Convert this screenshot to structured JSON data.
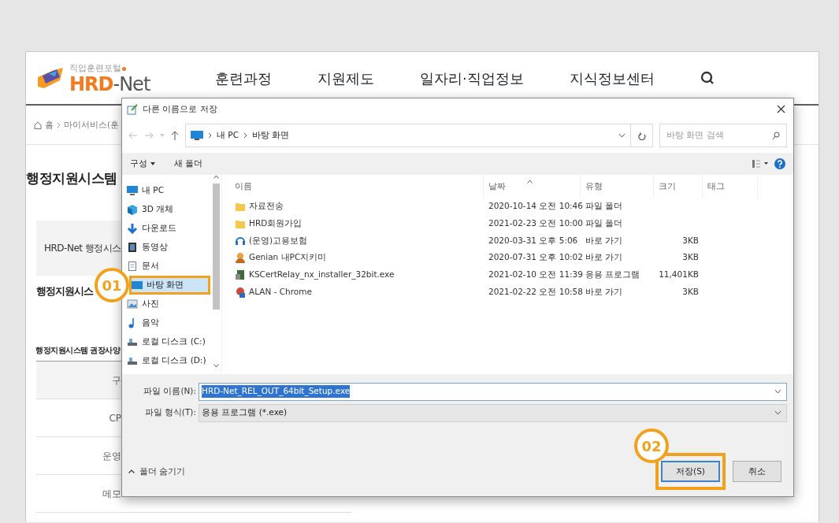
{
  "site": {
    "logo_tagline": "직업훈련포털",
    "logo_brand": "HRD",
    "logo_suffix": "-Net",
    "nav": [
      "훈련과정",
      "지원제도",
      "일자리·직업정보",
      "지식정보센터"
    ],
    "breadcrumb": [
      "홈",
      "마이서비스(훈"
    ],
    "page_title": "행정지원시스템",
    "banner_text": "HRD-Net 행정시스",
    "section_title": "행정지원시스",
    "spec_title": "행정지원시스템 권장사양",
    "spec_rows": [
      {
        "label": "구",
        "kind": "header"
      },
      {
        "label": "CP",
        "kind": "row"
      },
      {
        "label": "운영",
        "kind": "row"
      },
      {
        "label": "메모",
        "kind": "row"
      }
    ]
  },
  "dialog": {
    "title": "다른 이름으로 저장",
    "path": [
      "내 PC",
      "바탕 화면"
    ],
    "search_placeholder": "바탕 화면 검색",
    "toolbar": {
      "organize": "구성",
      "new_folder": "새 폴더"
    },
    "nav_tree": [
      {
        "label": "내 PC",
        "selected": false
      },
      {
        "label": "3D 개체",
        "selected": false
      },
      {
        "label": "다운로드",
        "selected": false
      },
      {
        "label": "동영상",
        "selected": false
      },
      {
        "label": "문서",
        "selected": false
      },
      {
        "label": "바탕 화면",
        "selected": true,
        "callout": "01"
      },
      {
        "label": "사진",
        "selected": false
      },
      {
        "label": "음악",
        "selected": false
      },
      {
        "label": "로컬 디스크 (C:)",
        "selected": false
      },
      {
        "label": "로컬 디스크 (D:)",
        "selected": false
      }
    ],
    "columns": [
      {
        "label": "이름",
        "sorted": false
      },
      {
        "label": "날짜",
        "sorted": true
      },
      {
        "label": "유형",
        "sorted": false
      },
      {
        "label": "크기",
        "sorted": false
      },
      {
        "label": "태그",
        "sorted": false
      }
    ],
    "files": [
      {
        "name": "자료전송",
        "date": "2020-10-14 오전 10:46",
        "type": "파일 폴더"
      },
      {
        "name": "HRD회원가입",
        "date": "2021-02-23 오전 10:00",
        "type": "파일 폴더"
      },
      {
        "name": "(운영)고용보험",
        "date": "2020-03-31 오후 5:06",
        "type": "바로 가기",
        "size": "3KB"
      },
      {
        "name": "Genian 내PC지키미",
        "date": "2020-07-31 오후 10:02",
        "type": "바로 가기",
        "size": "3KB"
      },
      {
        "name": "KSCertRelay_nx_installer_32bit.exe",
        "date": "2021-02-10 오전 11:39",
        "type": "응용 프로그램",
        "size": "11,401KB"
      },
      {
        "name": "ALAN - Chrome",
        "date": "2021-02-22 오전 10:58",
        "type": "바로 가기",
        "size": "3KB"
      }
    ],
    "filename_label": "파일 이름(N):",
    "filename": "HRD-Net_REL_OUT_64bit_Setup.exe",
    "filename_selected": true,
    "filetype_label": "파일 형식(T):",
    "filetype": "응용 프로그램 (*.exe)",
    "hide_folders": "폴더 숨기기",
    "buttons": [
      {
        "label": "저장(S)",
        "default": true,
        "callout": "02"
      },
      {
        "label": "취소",
        "default": false
      }
    ]
  }
}
